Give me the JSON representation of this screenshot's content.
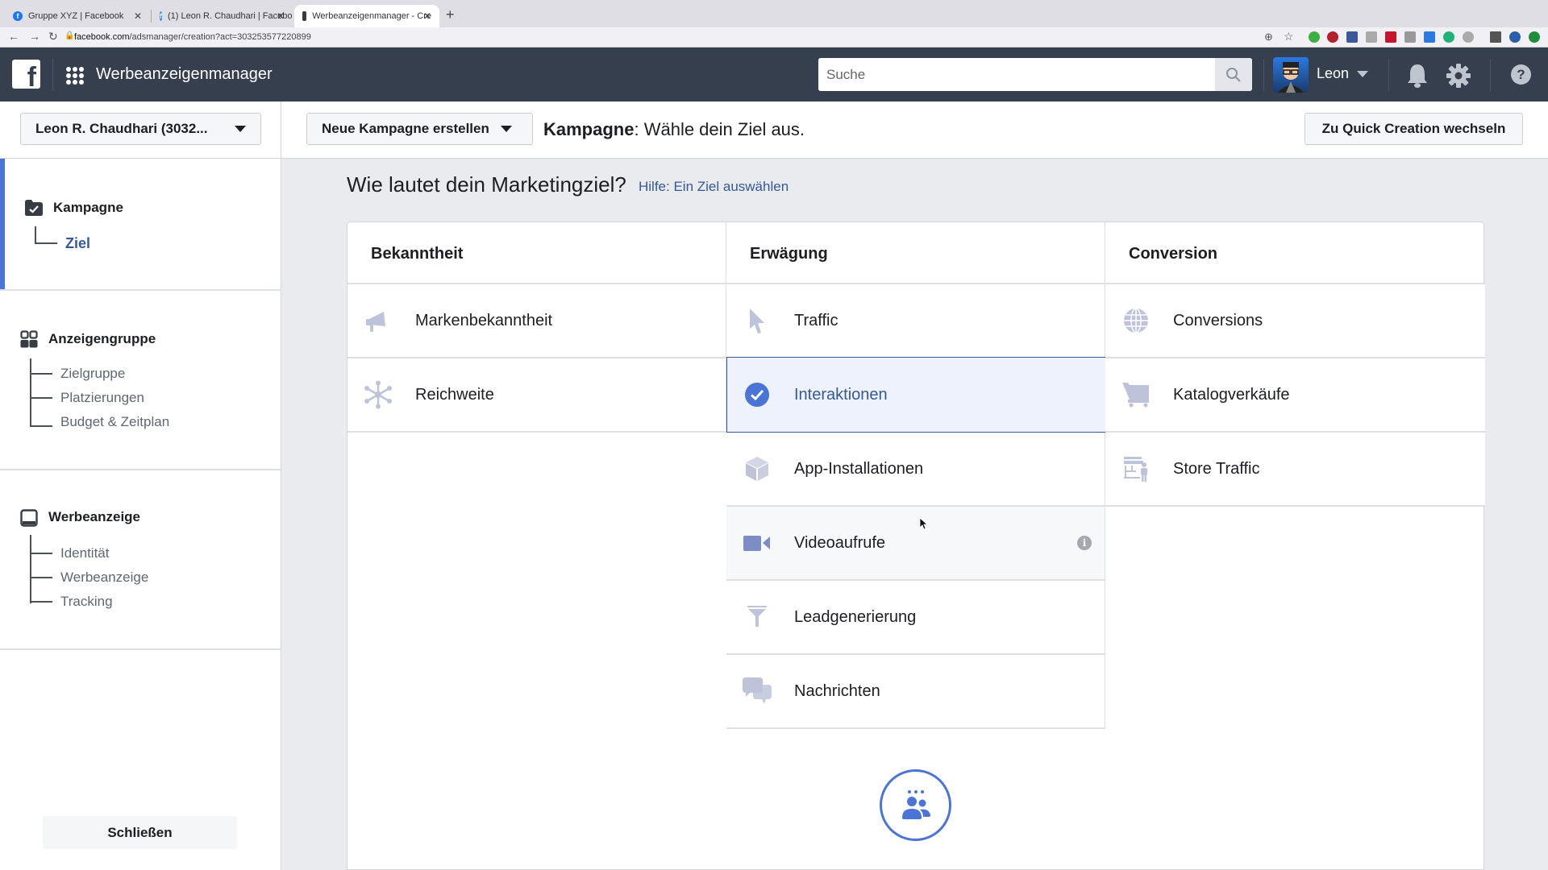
{
  "browser": {
    "tabs": [
      {
        "title": "Gruppe XYZ | Facebook",
        "icon": "facebook-icon",
        "active": false
      },
      {
        "title": "(1) Leon R. Chaudhari | Facebo",
        "icon": "facebook-icon",
        "active": false
      },
      {
        "title": "Werbeanzeigenmanager - Cre",
        "icon": "ads-manager-icon",
        "active": true
      }
    ],
    "url_host": "facebook.com",
    "url_path": "/adsmanager/creation?act=303253577220899"
  },
  "header": {
    "app_title": "Werbeanzeigenmanager",
    "search_placeholder": "Suche",
    "user_name": "Leon"
  },
  "subheader": {
    "account_selector": "Leon R. Chaudhari (3032...",
    "create_campaign": "Neue Kampagne erstellen",
    "breadcrumb_bold": "Kampagne",
    "breadcrumb_rest": ": Wähle dein Ziel aus.",
    "quick_creation": "Zu Quick Creation wechseln"
  },
  "sidebar": {
    "sections": [
      {
        "title": "Kampagne",
        "icon": "campaign-check-icon",
        "items": [
          {
            "label": "Ziel",
            "active": true
          }
        ]
      },
      {
        "title": "Anzeigengruppe",
        "icon": "adset-grid-icon",
        "items": [
          {
            "label": "Zielgruppe"
          },
          {
            "label": "Platzierungen"
          },
          {
            "label": "Budget & Zeitplan"
          }
        ]
      },
      {
        "title": "Werbeanzeige",
        "icon": "ad-icon",
        "items": [
          {
            "label": "Identität"
          },
          {
            "label": "Werbeanzeige"
          },
          {
            "label": "Tracking"
          }
        ]
      }
    ],
    "close_label": "Schließen"
  },
  "main": {
    "question": "Wie lautet dein Marketingziel?",
    "help_link": "Hilfe: Ein Ziel auswählen",
    "columns": [
      {
        "title": "Bekanntheit",
        "items": [
          {
            "label": "Markenbekanntheit",
            "icon": "megaphone-icon"
          },
          {
            "label": "Reichweite",
            "icon": "reach-icon"
          }
        ]
      },
      {
        "title": "Erwägung",
        "items": [
          {
            "label": "Traffic",
            "icon": "cursor-icon"
          },
          {
            "label": "Interaktionen",
            "icon": "checkmark-icon",
            "selected": true
          },
          {
            "label": "App-Installationen",
            "icon": "box-icon"
          },
          {
            "label": "Videoaufrufe",
            "icon": "video-camera-icon",
            "hovered": true,
            "info": "i"
          },
          {
            "label": "Leadgenerierung",
            "icon": "funnel-icon"
          },
          {
            "label": "Nachrichten",
            "icon": "chat-bubbles-icon"
          }
        ]
      },
      {
        "title": "Conversion",
        "items": [
          {
            "label": "Conversions",
            "icon": "globe-icon"
          },
          {
            "label": "Katalogverkäufe",
            "icon": "cart-icon"
          },
          {
            "label": "Store Traffic",
            "icon": "store-icon"
          }
        ]
      }
    ]
  },
  "colors": {
    "header_bg": "#353f4d",
    "accent": "#4a74d6",
    "link": "#365899",
    "selected_bg": "#edf2fc",
    "icon_muted": "#bec3d9"
  }
}
